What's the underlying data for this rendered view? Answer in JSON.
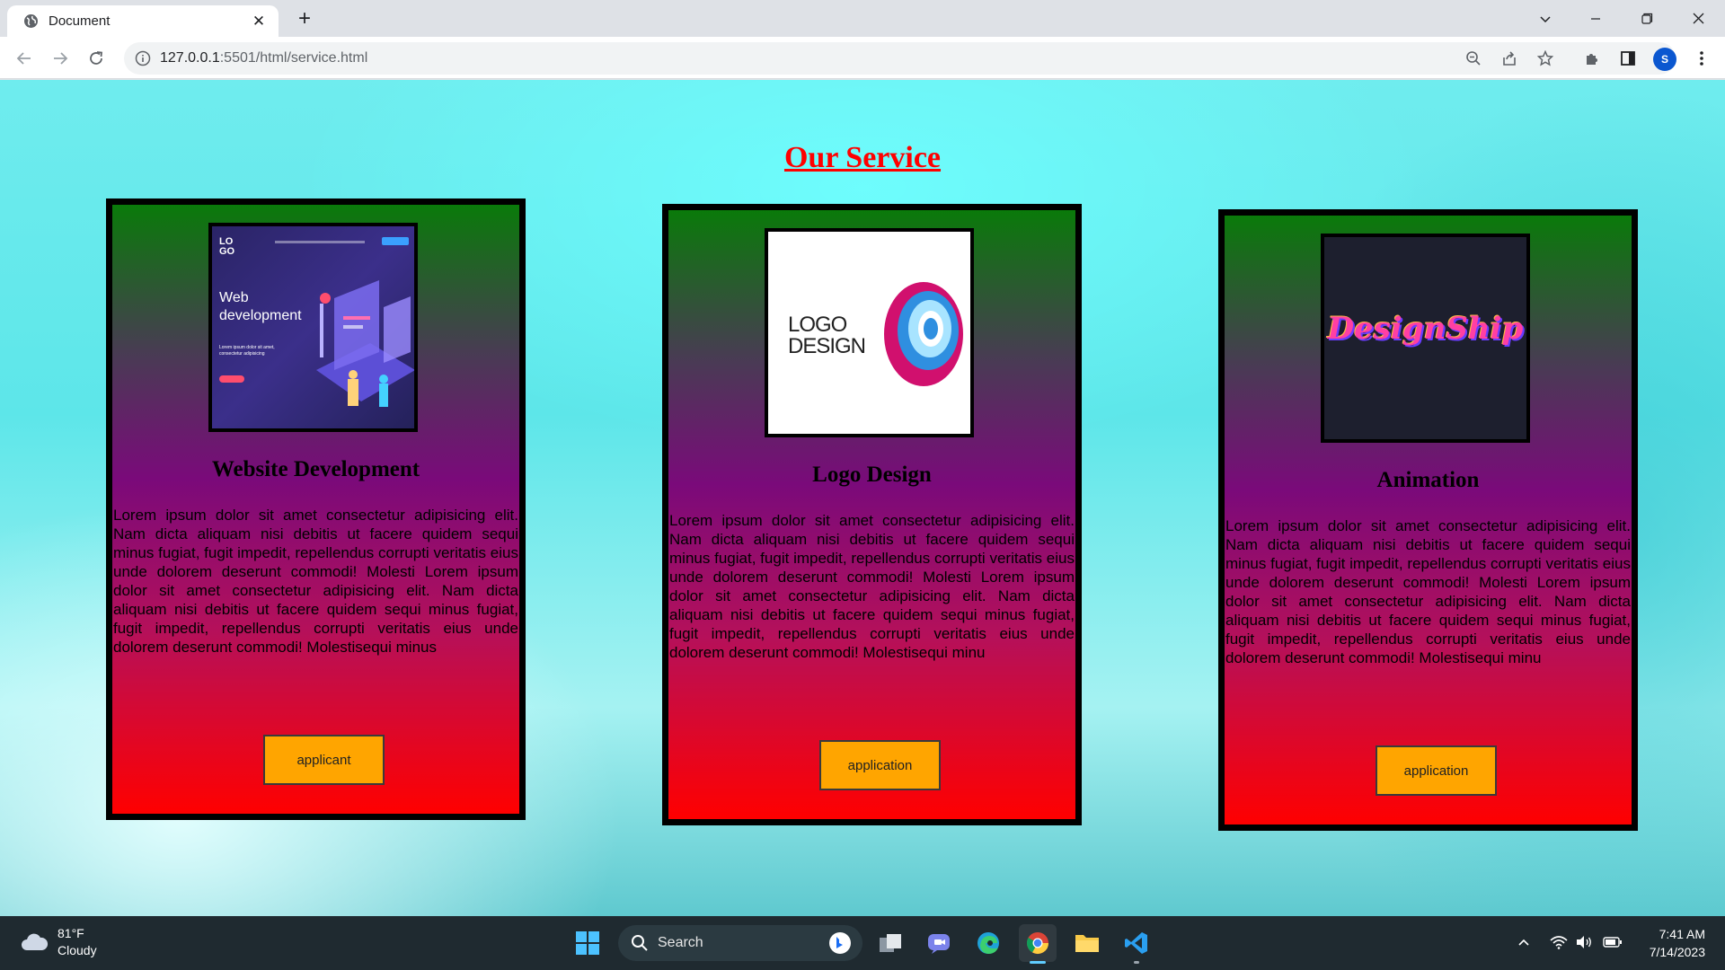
{
  "browser": {
    "tab_title": "Document",
    "url_host": "127.0.0.1",
    "url_rest": ":5501/html/service.html",
    "avatar_letter": "S"
  },
  "page": {
    "title": "Our Service",
    "cards": [
      {
        "title": "Website Development",
        "image_heading": "Web development",
        "image_logo": "LO GO",
        "image_sub": "Lorem ipsum dolor sit amet, consectetur adipisicing",
        "text": "Lorem ipsum dolor sit amet consectetur adipisicing elit. Nam dicta aliquam nisi debitis ut facere quidem sequi minus fugiat, fugit impedit, repellendus corrupti veritatis eius unde dolorem deserunt commodi! Molesti Lorem ipsum dolor sit amet consectetur adipisicing elit. Nam dicta aliquam nisi debitis ut facere quidem sequi minus fugiat, fugit impedit, repellendus corrupti veritatis eius unde dolorem deserunt commodi! Molestisequi minus",
        "button": "applicant"
      },
      {
        "title": "Logo Design",
        "image_line1": "LOGO",
        "image_line2": "DESIGN",
        "text": "Lorem ipsum dolor sit amet consectetur adipisicing elit. Nam dicta aliquam nisi debitis ut facere quidem sequi minus fugiat, fugit impedit, repellendus corrupti veritatis eius unde dolorem deserunt commodi! Molesti Lorem ipsum dolor sit amet consectetur adipisicing elit. Nam dicta aliquam nisi debitis ut facere quidem sequi minus fugiat, fugit impedit, repellendus corrupti veritatis eius unde dolorem deserunt commodi! Molestisequi minu",
        "button": "application"
      },
      {
        "title": "Animation",
        "image_word": "DesignShip",
        "text": "Lorem ipsum dolor sit amet consectetur adipisicing elit. Nam dicta aliquam nisi debitis ut facere quidem sequi minus fugiat, fugit impedit, repellendus corrupti veritatis eius unde dolorem deserunt commodi! Molesti Lorem ipsum dolor sit amet consectetur adipisicing elit. Nam dicta aliquam nisi debitis ut facere quidem sequi minus fugiat, fugit impedit, repellendus corrupti veritatis eius unde dolorem deserunt commodi! Molestisequi minu",
        "button": "application"
      }
    ]
  },
  "taskbar": {
    "weather_temp": "81°F",
    "weather_desc": "Cloudy",
    "search_label": "Search",
    "time": "7:41 AM",
    "date": "7/14/2023"
  },
  "colors": {
    "title": "#ff0000",
    "button": "#ffa500",
    "card_top": "#0a7a0a",
    "card_mid": "#7a0a7a",
    "card_bottom": "#ff0000"
  }
}
